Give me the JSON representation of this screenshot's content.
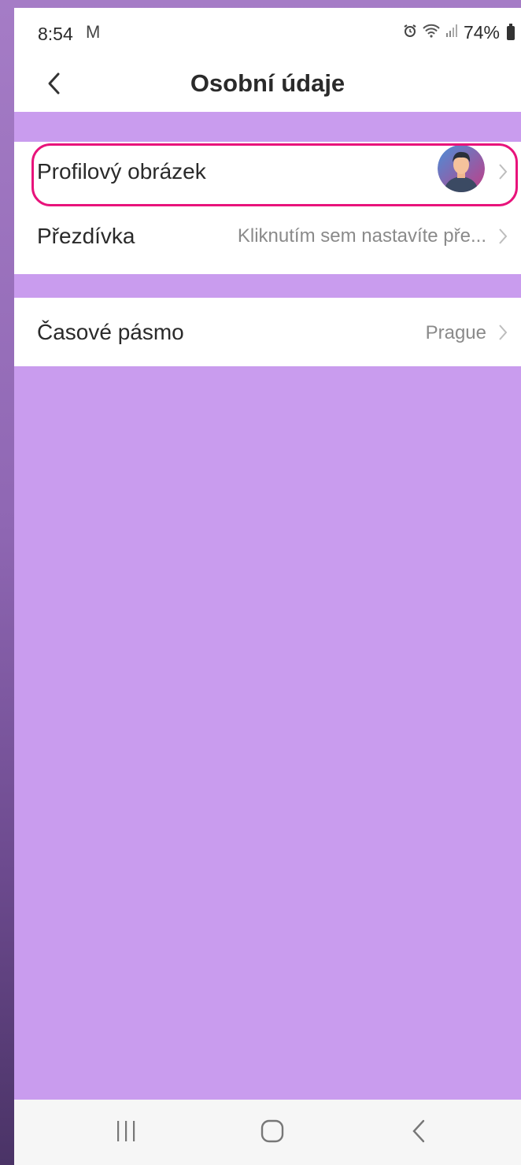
{
  "status_bar": {
    "time": "8:54",
    "mail_icon": "M",
    "battery_percent": "74%"
  },
  "header": {
    "title": "Osobní údaje"
  },
  "rows": [
    {
      "label": "Profilový obrázek",
      "value": ""
    },
    {
      "label": "Přezdívka",
      "value": "Kliknutím sem nastavíte pře..."
    },
    {
      "label": "Časové pásmo",
      "value": "Prague"
    }
  ],
  "icons": {
    "back": "chevron-left-icon",
    "row_chevron": "chevron-right-icon",
    "nav_recents": "recent-apps-icon",
    "nav_home": "home-icon",
    "nav_back": "back-icon"
  },
  "colors": {
    "background": "#c99cee",
    "highlight": "#e8137b",
    "card": "#ffffff"
  }
}
